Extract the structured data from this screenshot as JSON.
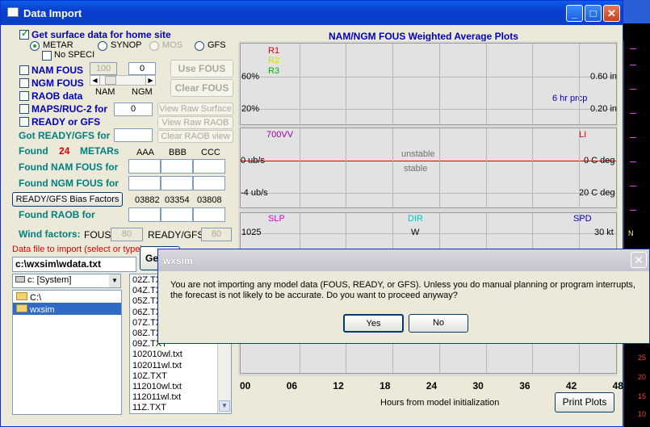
{
  "window": {
    "title": "Data Import"
  },
  "left": {
    "get_surface": "Get surface data for home site",
    "metar": "METAR",
    "synop": "SYNOP",
    "mos": "MOS",
    "gfs": "GFS",
    "no_speci": "No SPECI",
    "nam_fous": "NAM FOUS",
    "ngm_fous": "NGM FOUS",
    "raob": "RAOB data",
    "maps": "MAPS/RUC-2 for",
    "ready": "READY or GFS",
    "got_ready": "Got READY/GFS for",
    "nam_val": "100",
    "ngm_val": "0",
    "nam_lbl": "NAM",
    "ngm_lbl": "NGM",
    "maps_val": "0",
    "use_fous": "Use FOUS",
    "clear_fous": "Clear FOUS",
    "view_surface": "View Raw Surface",
    "view_raob": "View Raw RAOB",
    "clear_raob": "Clear RAOB view",
    "found": "Found",
    "found_count": "24",
    "metars": "METARs",
    "aaa": "AAA",
    "bbb": "BBB",
    "ccc": "CCC",
    "found_nam": "Found NAM FOUS for",
    "found_ngm": "Found NGM FOUS for",
    "bias_btn": "READY/GFS Bias Factors",
    "code1": "03882",
    "code2": "03354",
    "code3": "03808",
    "found_raob": "Found RAOB for",
    "wind_factors": "Wind factors:",
    "fous_lbl": "FOUS",
    "fous_val": "80",
    "readygfs_lbl": "READY/GFS",
    "readygfs_val": "80",
    "file_label": "Data file to import (select or type)",
    "file_path": "c:\\wxsim\\wdata.txt",
    "get_btn": "Ge",
    "drive": "c: [System]",
    "folders": [
      "C:\\",
      "wxsim"
    ],
    "files": [
      "02Z.TXT",
      "04Z.TXT",
      "05Z.TXT",
      "06Z.TXT",
      "07Z.TXT",
      "08Z.TXT",
      "09Z.TXT",
      "102010wl.txt",
      "102011wl.txt",
      "10Z.TXT",
      "112010wl.txt",
      "112011wl.txt",
      "11Z.TXT"
    ]
  },
  "plot": {
    "title": "NAM/NGM FOUS Weighted Average Plots",
    "r1": "R1",
    "r2": "R2",
    "r3": "R3",
    "p60": "60%",
    "p20": "20%",
    "in060": "0.60 in",
    "in020": "0.20 in",
    "hrprcp": "6 hr prcp",
    "vv": "700VV",
    "li": "LI",
    "unstable": "unstable",
    "stable": "stable",
    "ub0": "0 ub/s",
    "ub4": "-4 ub/s",
    "c0": "0 C deg",
    "c20": "20 C deg",
    "slp": "SLP",
    "dir": "DIR",
    "spd": "SPD",
    "p1025": "1025",
    "w": "W",
    "kt30": "30 kt",
    "xticks": [
      "00",
      "06",
      "12",
      "18",
      "24",
      "30",
      "36",
      "42",
      "48"
    ],
    "xlabel": "Hours from model initialization",
    "print_btn": "Print Plots"
  },
  "dialog": {
    "title": "wxsim",
    "message": "You are not importing any model data (FOUS, READY, or GFS).  Unless you do manual planning or program interrupts, the forecast is not likely to be accurate.  Do you want to proceed anyway?",
    "yes": "Yes",
    "no": "No"
  },
  "bg": {
    "ticks": [
      "N",
      "25",
      "20",
      "15",
      "10"
    ]
  }
}
